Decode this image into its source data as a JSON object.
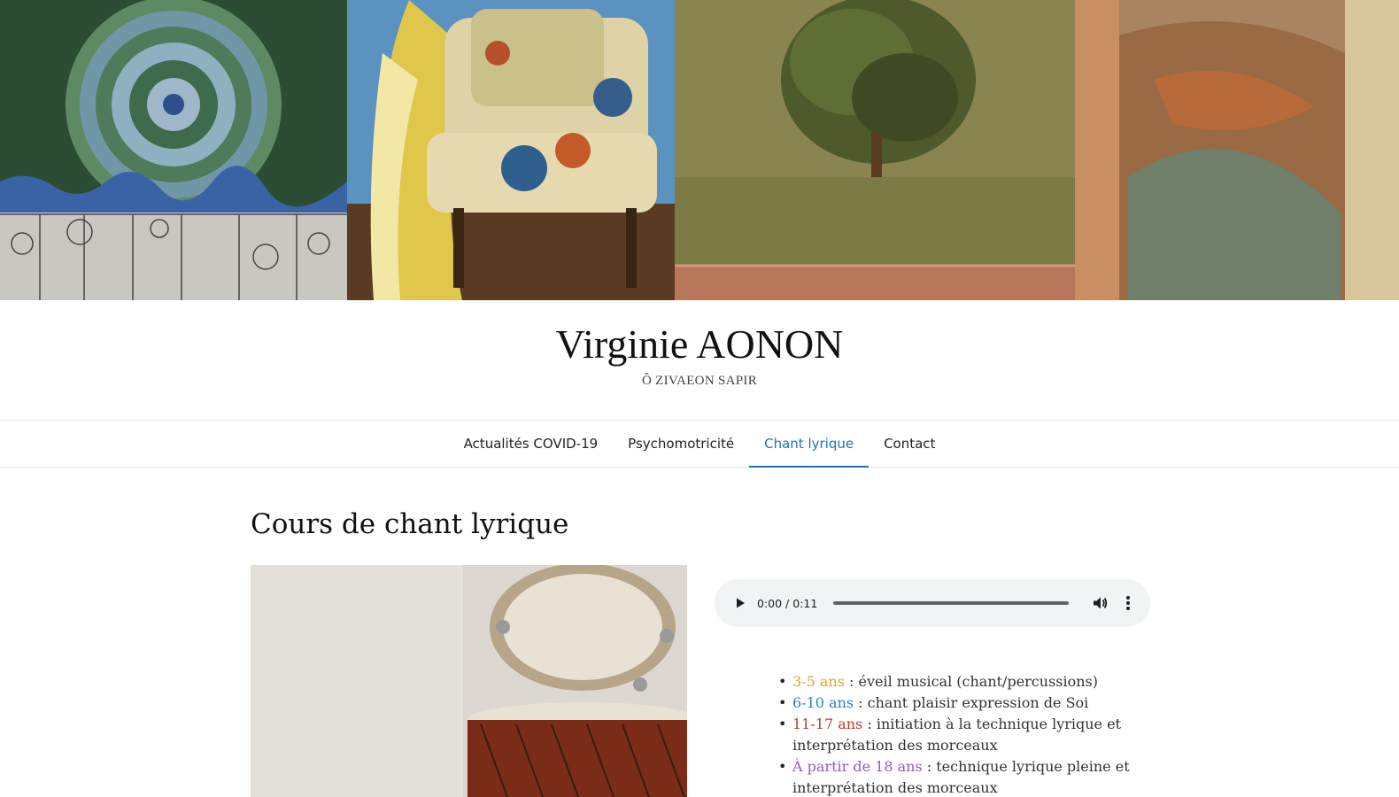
{
  "header": {
    "banner_panels": [
      "mosaic-plate",
      "floral-armchair",
      "tree-fresco",
      "lace-textile"
    ],
    "site_title": "Virginie AONON",
    "tagline": "Ô ZIVAEON SAPIR"
  },
  "nav": {
    "items": [
      {
        "label": "Actualités COVID-19"
      },
      {
        "label": "Psychomotricité"
      },
      {
        "label": "Chant lyrique"
      },
      {
        "label": "Contact"
      }
    ],
    "active_index": 2,
    "active_color": "#1e73be"
  },
  "main": {
    "title": "Cours de chant lyrique",
    "image_subject": "tambourine-on-djembe",
    "audio": {
      "time": "0:00 / 0:11"
    },
    "ages": [
      {
        "age": "3-5 ans",
        "separator": " : ",
        "text": "éveil musical (chant/percussions)",
        "color": "#e0a030"
      },
      {
        "age": "6-10 ans",
        "separator": " : ",
        "text": "chant plaisir expression de Soi",
        "color": "#2f7fc8"
      },
      {
        "age": "11-17 ans",
        "separator": " : ",
        "text": "initiation à la technique lyrique et interprétation des morceaux",
        "color": "#c0392b"
      },
      {
        "age": "À partir de 18 ans",
        "separator": " : ",
        "text": "technique lyrique pleine et interprétation des morceaux",
        "color": "#8e5cc8"
      }
    ]
  }
}
